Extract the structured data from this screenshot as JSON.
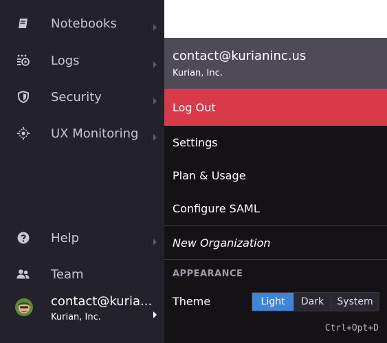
{
  "sidebar": {
    "items": [
      {
        "label": "Notebooks",
        "icon": "notebook-icon"
      },
      {
        "label": "Logs",
        "icon": "logs-icon"
      },
      {
        "label": "Security",
        "icon": "shield-icon"
      },
      {
        "label": "UX Monitoring",
        "icon": "ux-monitoring-icon"
      },
      {
        "label": "Help",
        "icon": "help-icon"
      },
      {
        "label": "Team",
        "icon": "team-icon"
      }
    ],
    "account": {
      "email": "contact@kuria...",
      "org": "Kurian, Inc.",
      "avatar_icon": "avatar-icon"
    }
  },
  "account_menu": {
    "header": {
      "email": "contact@kurianinc.us",
      "org": "Kurian, Inc."
    },
    "logout_label": "Log Out",
    "items": [
      {
        "label": "Settings"
      },
      {
        "label": "Plan & Usage"
      },
      {
        "label": "Configure SAML"
      },
      {
        "label": "New Organization"
      }
    ],
    "appearance": {
      "section_label": "APPEARANCE",
      "theme_label": "Theme",
      "options": [
        "Light",
        "Dark",
        "System"
      ],
      "selected": "Light",
      "shortcut": "Ctrl+Opt+D"
    }
  },
  "colors": {
    "sidebar_bg": "#232129",
    "menu_bg": "#141215",
    "menu_header_bg": "#4e4b57",
    "logout_red": "#d93a4a",
    "toggle_active_blue": "#3d85d8"
  }
}
